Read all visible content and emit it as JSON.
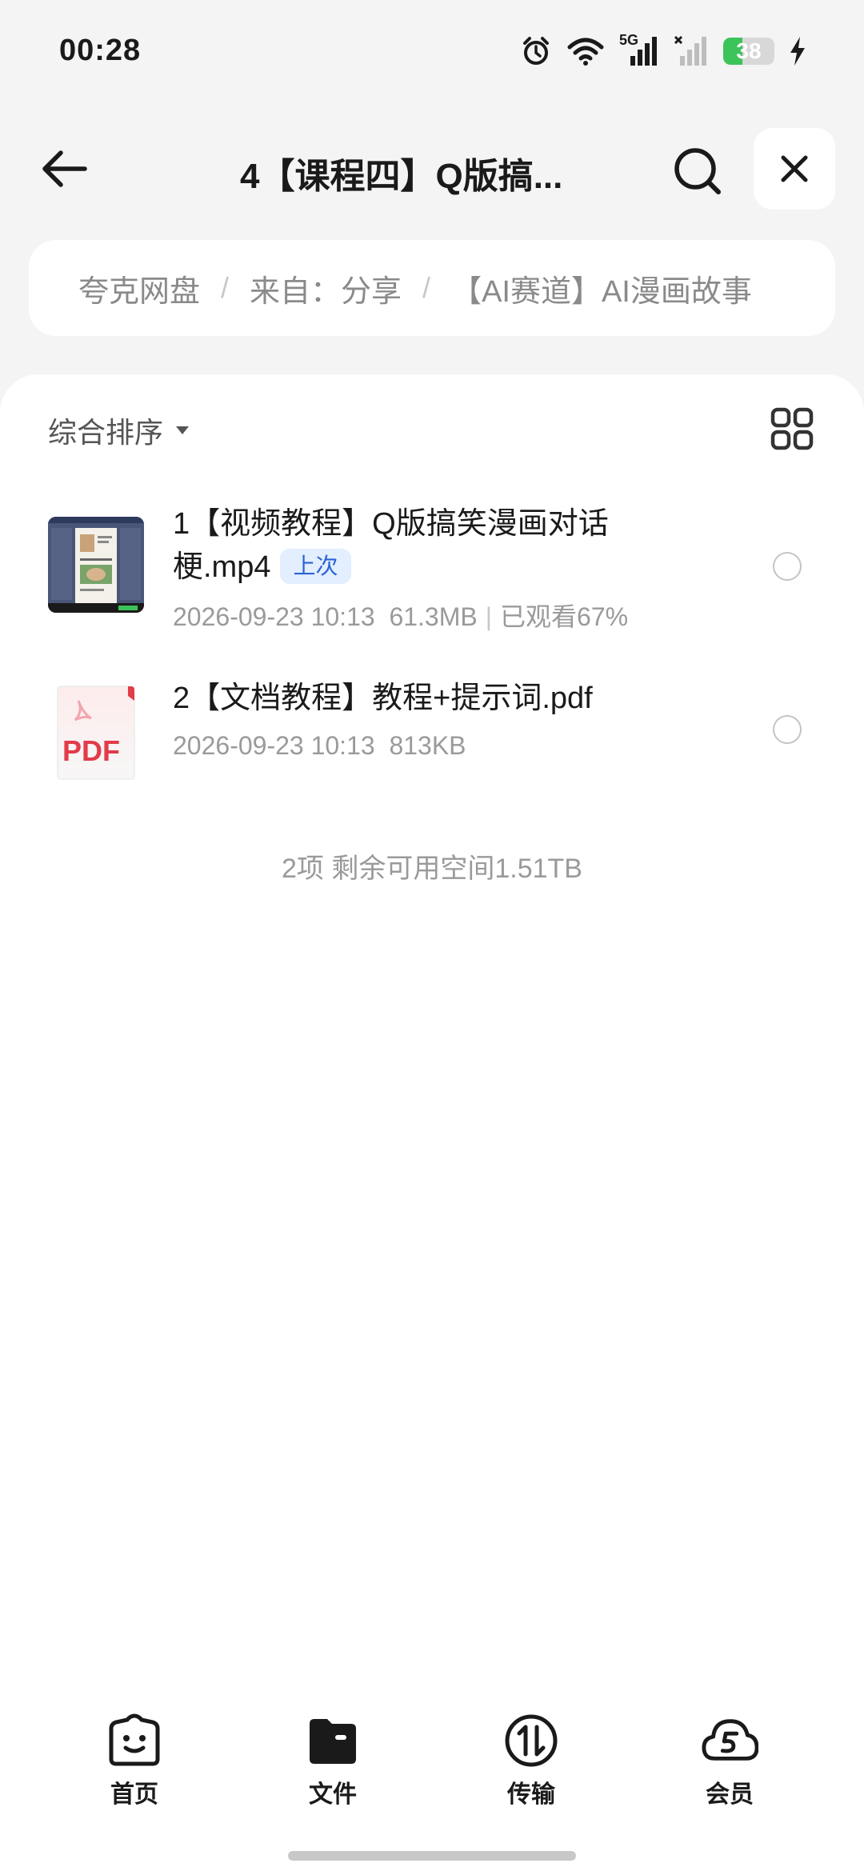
{
  "status_bar": {
    "time": "00:28",
    "network": "5G",
    "battery": "38",
    "battery_level": 0.38,
    "icons": [
      "alarm-icon",
      "wifi-icon",
      "signal-5g-icon",
      "signal-no-sim-icon",
      "battery-icon",
      "charging-icon"
    ]
  },
  "header": {
    "title": "4【课程四】Q版搞...",
    "back_icon": "arrow-left-icon",
    "search_icon": "search-icon",
    "close_icon": "close-icon"
  },
  "breadcrumb": {
    "items": [
      "夸克网盘",
      "来自：分享",
      "【AI赛道】AI漫画故事"
    ],
    "separator": "/"
  },
  "toolbar": {
    "sort_label": "综合排序",
    "sort_icon": "caret-down-icon",
    "view_icon": "grid-view-icon"
  },
  "files": [
    {
      "name": "1【视频教程】Q版搞笑漫画对话梗.mp4",
      "badge": "上次",
      "date": "2026-09-23 10:13",
      "size": "61.3MB",
      "extra": "已观看67%",
      "icon": "video-thumbnail"
    },
    {
      "name": "2【文档教程】教程+提示词.pdf",
      "date": "2026-09-23 10:13",
      "size": "813KB",
      "icon": "pdf-file-icon",
      "icon_text": "PDF"
    }
  ],
  "footer_info": "2项 剩余可用空间1.51TB",
  "nav": [
    {
      "label": "首页",
      "icon": "home-face-icon"
    },
    {
      "label": "文件",
      "icon": "folder-icon"
    },
    {
      "label": "传输",
      "icon": "transfer-icon"
    },
    {
      "label": "会员",
      "icon": "vip-cloud-icon"
    }
  ],
  "colors": {
    "accent": "#2a63d6",
    "battery": "#3cc35a",
    "pdf_red": "#e23b4a"
  }
}
